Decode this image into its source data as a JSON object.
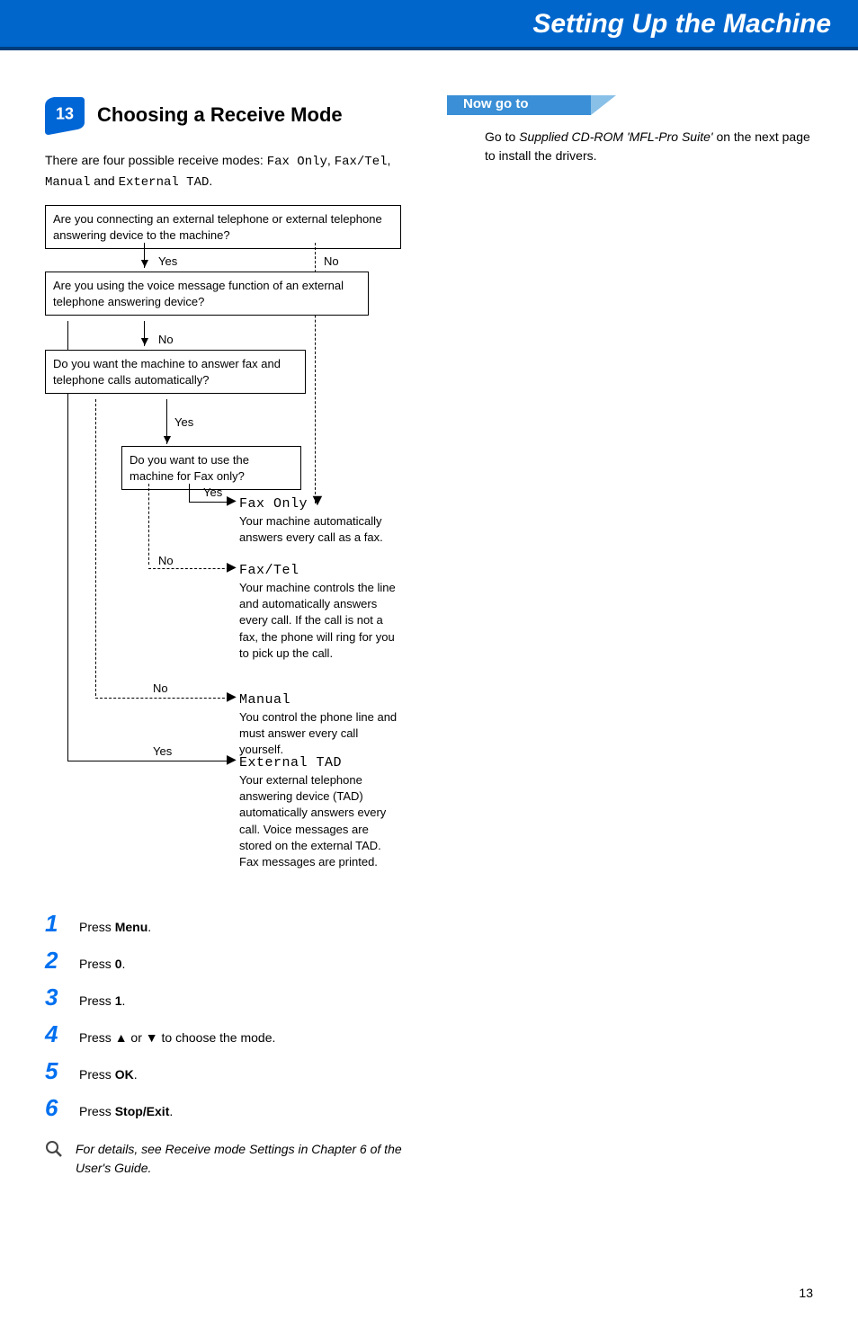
{
  "header": {
    "title": "Setting Up the Machine"
  },
  "section": {
    "number": "13",
    "title": "Choosing a Receive Mode",
    "intro_pre": "There are four possible receive modes: ",
    "modes": {
      "m1": "Fax Only",
      "m2": "Fax/Tel",
      "m3": "Manual",
      "m4": "External TAD"
    },
    "intro_mid": ", ",
    "intro_and": " and ",
    "intro_end": "."
  },
  "flow": {
    "q1": "Are you connecting an external telephone or external telephone answering device to the machine?",
    "q2": "Are you using the voice message function of an external telephone answering device?",
    "q3": "Do you want the machine to answer fax and telephone calls automatically?",
    "q4": "Do you want to use the machine for Fax only?",
    "yes": "Yes",
    "no": "No",
    "r1": {
      "title": "Fax Only",
      "desc": "Your machine automatically answers every call as a fax."
    },
    "r2": {
      "title": "Fax/Tel",
      "desc": "Your machine controls the line and automatically answers every call. If the call is not a fax, the phone will ring for you to pick up the call."
    },
    "r3": {
      "title": "Manual",
      "desc": "You control the phone line and must answer every call yourself."
    },
    "r4": {
      "title": "External TAD",
      "desc": "Your external telephone answering device (TAD) automatically answers every call. Voice messages are stored on the external TAD. Fax messages are printed."
    }
  },
  "steps": {
    "s1": {
      "pre": "Press ",
      "bold": "Menu",
      "post": "."
    },
    "s2": {
      "pre": "Press ",
      "bold": "0",
      "post": "."
    },
    "s3": {
      "pre": "Press ",
      "bold": "1",
      "post": "."
    },
    "s4": {
      "pre": "Press ",
      "mid": " or ",
      "post": " to choose the mode."
    },
    "s5": {
      "pre": "Press ",
      "bold": "OK",
      "post": "."
    },
    "s6": {
      "pre": "Press ",
      "bold": "Stop/Exit",
      "post": "."
    }
  },
  "note": "For details, see Receive mode Settings in Chapter 6 of the User's Guide.",
  "goto": {
    "label": "Now go to",
    "pre": "Go to ",
    "ital": "Supplied CD-ROM 'MFL-Pro Suite'",
    "post": " on the next page to install the drivers."
  },
  "page_number": "13"
}
